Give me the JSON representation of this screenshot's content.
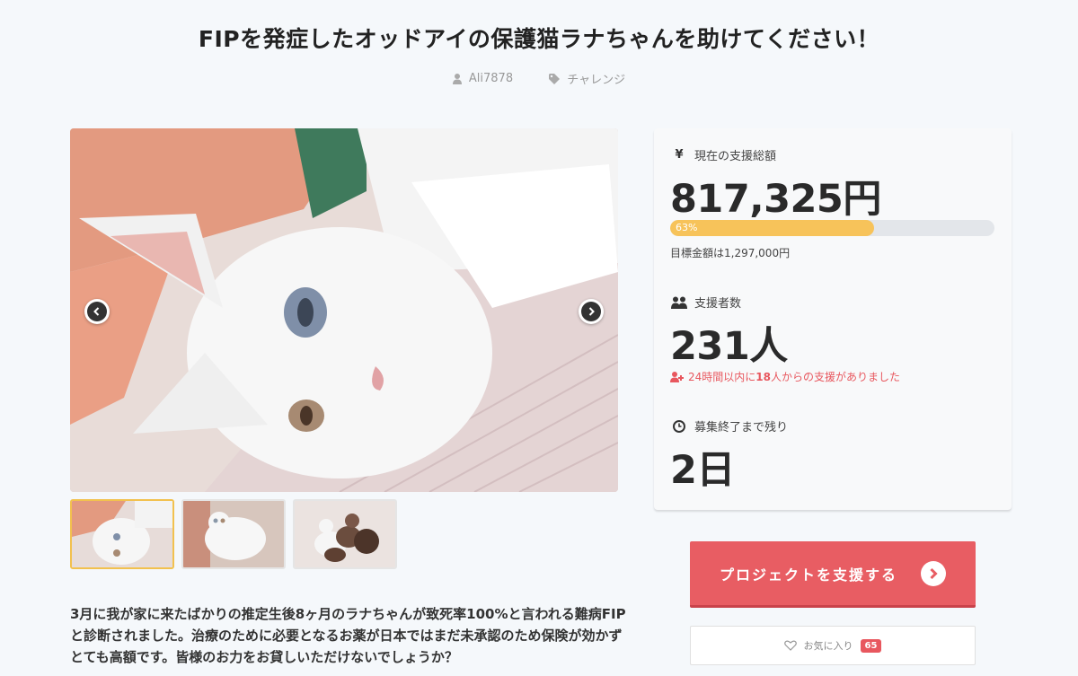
{
  "header": {
    "title": "FIPを発症したオッドアイの保護猫ラナちゃんを助けてください！",
    "author": "Ali7878",
    "category": "チャレンジ"
  },
  "gallery": {
    "prev_icon": "chevron-left-icon",
    "next_icon": "chevron-right-icon",
    "thumbnails": [
      "thumbnail-1",
      "thumbnail-2",
      "thumbnail-3"
    ],
    "active_index": 0
  },
  "description": "3月に我が家に来たばかりの推定生後8ヶ月のラナちゃんが致死率100%と言われる難病FIPと診断されました。治療のために必要となるお薬が日本ではまだ未承認のため保険が効かずとても高額です。皆様のお力をお貸しいただけないでしょうか？",
  "stats": {
    "total_label": "現在の支援総額",
    "total_icon": "¥",
    "total_amount": "817,325円",
    "progress_percent": 63,
    "progress_label": "63%",
    "target_text": "目標金額は1,297,000円",
    "supporters_label": "支援者数",
    "supporters_count": "231人",
    "recent_prefix": "24時間以内に",
    "recent_count": "18",
    "recent_suffix": "人からの支援がありました",
    "remaining_label": "募集終了まで残り",
    "remaining_value": "2日"
  },
  "actions": {
    "support_label": "プロジェクトを支援する",
    "favorite_label": "お気に入り",
    "favorite_count": "65"
  },
  "colors": {
    "accent": "#e85d63",
    "progress": "#f7c35a",
    "active_thumb_border": "#f2c14e"
  }
}
